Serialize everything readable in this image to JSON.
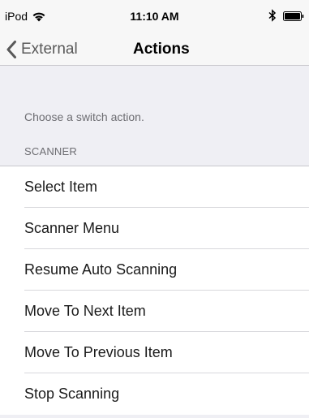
{
  "status": {
    "device": "iPod",
    "time": "11:10 AM"
  },
  "icons": {
    "wifi": "wifi-icon",
    "bluetooth": "bluetooth-icon",
    "battery": "battery-icon",
    "back": "chevron-left-icon"
  },
  "nav": {
    "back_label": "External",
    "title": "Actions"
  },
  "helper_text": "Choose a switch action.",
  "section": {
    "header": "SCANNER",
    "items": [
      {
        "label": "Select Item"
      },
      {
        "label": "Scanner Menu"
      },
      {
        "label": "Resume Auto Scanning"
      },
      {
        "label": "Move To Next Item"
      },
      {
        "label": "Move To Previous Item"
      },
      {
        "label": "Stop Scanning"
      }
    ]
  },
  "colors": {
    "background": "#efeff4",
    "bar": "#f7f7f7",
    "secondary_text": "#6d6d72",
    "back_text": "#595959"
  }
}
